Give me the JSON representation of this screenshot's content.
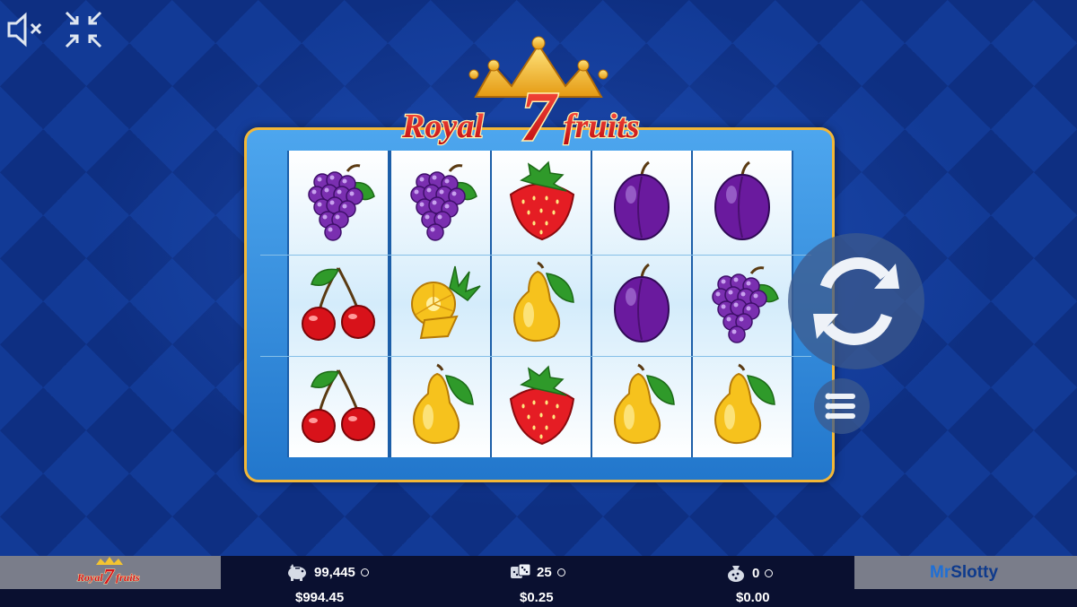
{
  "game": {
    "title_part1": "Royal",
    "title_seven": "7",
    "title_part2": "fruits"
  },
  "reels": [
    [
      "grapes",
      "cherries",
      "cherries"
    ],
    [
      "grapes",
      "pineapple",
      "pear"
    ],
    [
      "strawberry",
      "pear",
      "strawberry"
    ],
    [
      "plum",
      "plum",
      "pear"
    ],
    [
      "plum",
      "grapes",
      "pear"
    ]
  ],
  "status_bar": {
    "coins_balance": "99,445",
    "money_balance": "$994.45",
    "bet_coins": "25",
    "bet_money": "$0.25",
    "win_coins": "0",
    "win_money": "$0.00",
    "brand_mr": "Mr",
    "brand_slotty": "Slotty",
    "mini_logo": "Royal 7 fruits"
  },
  "icons": {
    "mute": "speaker-muted-icon",
    "fullscreen": "exit-fullscreen-icon",
    "spin": "spin-arrows-icon",
    "menu": "hamburger-menu-icon",
    "balance": "piggy-bank-icon",
    "bet": "dice-icon",
    "win": "coin-bag-icon"
  },
  "colors": {
    "background": "#0d2a7a",
    "frame_border": "#f3b737",
    "title_red": "#d8121a",
    "title_gold": "#f4c430"
  }
}
